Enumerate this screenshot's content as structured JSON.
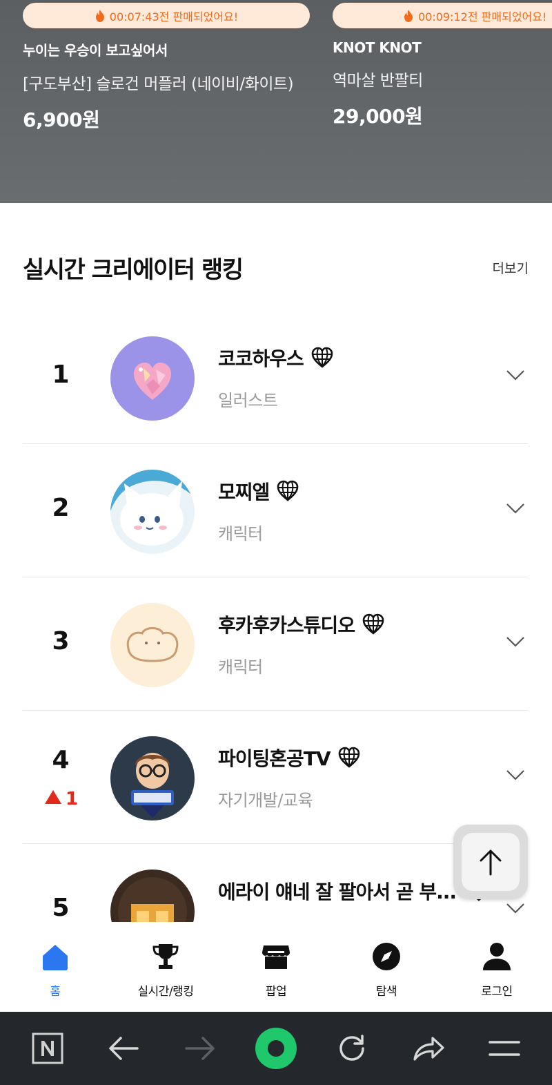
{
  "hero": {
    "cards": [
      {
        "sold_text": "00:07:43전 판매되었어요!",
        "shop": "누이는 우승이 보고싶어서",
        "product": "[구도부산] 슬로건 머플러 (네이비/화이트)",
        "price": "6,900원"
      },
      {
        "sold_text": "00:09:12전 판매되었어요!",
        "shop": "KNOT KNOT",
        "product": "역마살 반팔티",
        "price": "29,000원"
      }
    ]
  },
  "ranking": {
    "title": "실시간 크리에이터 랭킹",
    "more_label": "더보기",
    "items": [
      {
        "rank": "1",
        "name": "코코하우스",
        "category": "일러스트",
        "change": "",
        "avatar": "crystal-heart"
      },
      {
        "rank": "2",
        "name": "모찌엘",
        "category": "캐릭터",
        "change": "",
        "avatar": "white-cat"
      },
      {
        "rank": "3",
        "name": "후카후카스튜디오",
        "category": "캐릭터",
        "change": "",
        "avatar": "bread"
      },
      {
        "rank": "4",
        "name": "파이팅혼공TV",
        "category": "자기개발/교육",
        "change": "1",
        "avatar": "glasses-boy"
      },
      {
        "rank": "5",
        "name": "에라이 얘네 잘 팔아서 곧 부...",
        "category": "",
        "change": "",
        "avatar": "gold-letters"
      }
    ]
  },
  "tabbar": {
    "tabs": [
      {
        "label": "홈",
        "icon": "home-icon",
        "active": true
      },
      {
        "label": "실시간/랭킹",
        "icon": "trophy-icon",
        "active": false
      },
      {
        "label": "팝업",
        "icon": "store-icon",
        "active": false
      },
      {
        "label": "탐색",
        "icon": "compass-icon",
        "active": false
      },
      {
        "label": "로그인",
        "icon": "person-icon",
        "active": false
      }
    ]
  },
  "browser": {
    "buttons": [
      "naver-n-icon",
      "back-icon",
      "forward-icon",
      "green-dot-icon",
      "refresh-icon",
      "share-icon",
      "menu-icon"
    ]
  },
  "colors": {
    "accent_orange": "#f26a1b",
    "pill_bg": "#ffe9d9",
    "active_blue": "#2a77f0",
    "rank_up_red": "#e02a1b",
    "browser_green": "#1fc96b"
  }
}
